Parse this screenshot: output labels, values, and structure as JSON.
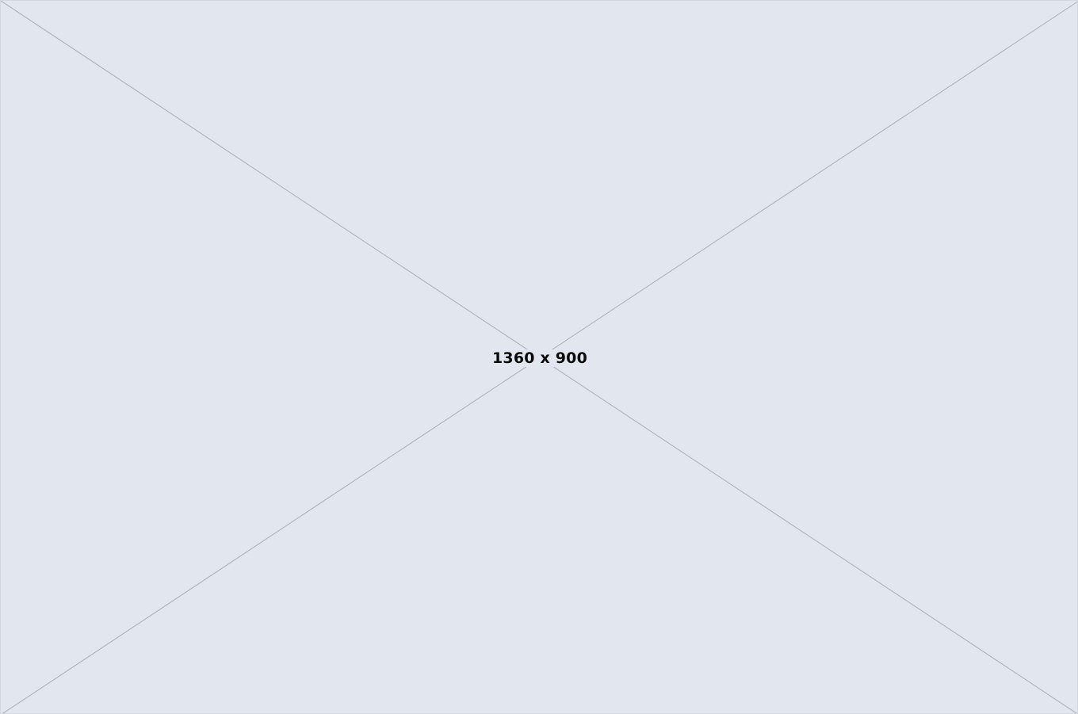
{
  "placeholder": {
    "dimensions_label": "1360 x 900",
    "background_color": "#e2e6ee",
    "line_color": "#a9acbb",
    "text_color": "#0b0b0b"
  }
}
